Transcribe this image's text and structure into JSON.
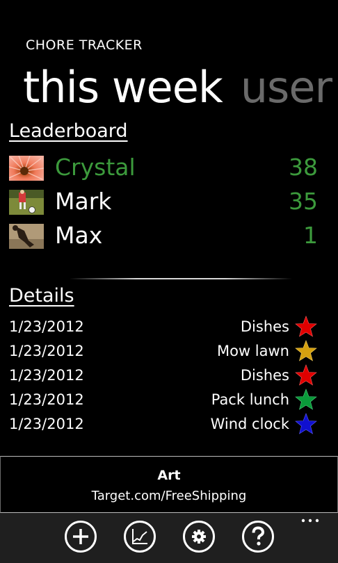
{
  "app": {
    "title": "CHORE TRACKER"
  },
  "pivot": {
    "active": "this week",
    "next": "user"
  },
  "leaderboard": {
    "heading": "Leaderboard",
    "rows": [
      {
        "name": "Crystal",
        "score": "38",
        "name_color": "#3c9a3c",
        "avatar_icon": "flower-photo"
      },
      {
        "name": "Mark",
        "score": "35",
        "name_color": "#ffffff",
        "avatar_icon": "soccer-photo"
      },
      {
        "name": "Max",
        "score": "1",
        "name_color": "#ffffff",
        "avatar_icon": "shadow-photo"
      }
    ]
  },
  "details": {
    "heading": "Details",
    "rows": [
      {
        "date": "1/23/2012",
        "task": "Dishes",
        "star_color": "#e00000"
      },
      {
        "date": "1/23/2012",
        "task": "Mow lawn",
        "star_color": "#d4a010"
      },
      {
        "date": "1/23/2012",
        "task": "Dishes",
        "star_color": "#e00000"
      },
      {
        "date": "1/23/2012",
        "task": "Pack lunch",
        "star_color": "#0a9a3a"
      },
      {
        "date": "1/23/2012",
        "task": "Wind clock",
        "star_color": "#1010d0"
      }
    ]
  },
  "ad": {
    "title": "Art",
    "subtitle": "Target.com/FreeShipping"
  },
  "appbar": {
    "buttons": [
      "add-icon",
      "chart-icon",
      "settings-icon",
      "help-icon"
    ],
    "more": "more-ellipsis-icon"
  },
  "colors": {
    "accent": "#3c9a3c",
    "background": "#000000",
    "appbar": "#1f1f1f"
  }
}
